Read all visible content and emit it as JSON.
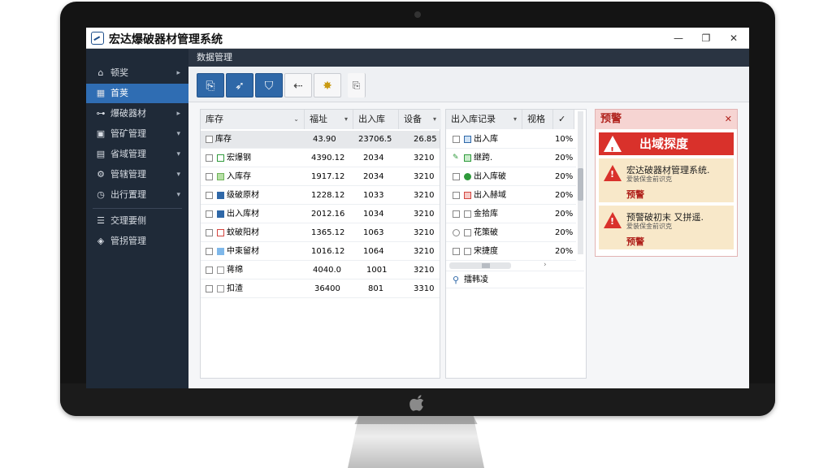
{
  "app": {
    "title": "宏达爆破器材管理系统"
  },
  "window_controls": {
    "minimize": "—",
    "maximize": "❐",
    "close": "✕"
  },
  "sidebar": {
    "items": [
      {
        "label": "顿奖",
        "icon": "home-icon",
        "arrow": "▸"
      },
      {
        "label": "首荚",
        "icon": "grid-icon",
        "arrow": ""
      },
      {
        "label": "爆破器材",
        "icon": "sitemap-icon",
        "arrow": "▸"
      },
      {
        "label": "管矿管理",
        "icon": "box-icon",
        "arrow": "▾"
      },
      {
        "label": "省域管理",
        "icon": "folder-icon",
        "arrow": "▾"
      },
      {
        "label": "管辖管理",
        "icon": "settings-icon",
        "arrow": "▾"
      },
      {
        "label": "出行置理",
        "icon": "clock-icon",
        "arrow": "▾"
      },
      {
        "label": "交理要侧",
        "icon": "list-icon",
        "arrow": ""
      },
      {
        "label": "管拐管理",
        "icon": "shield-icon",
        "arrow": ""
      }
    ]
  },
  "main": {
    "section_title": "数据管理",
    "toolbar": [
      {
        "name": "file-button",
        "icon": "file-icon",
        "glyph": "⎘",
        "style": "blue"
      },
      {
        "name": "rocket-button",
        "icon": "rocket-icon",
        "glyph": "➶",
        "style": "blue"
      },
      {
        "name": "filter-button",
        "icon": "filter-icon",
        "glyph": "⛉",
        "style": "blue"
      },
      {
        "name": "transfer-button",
        "icon": "transfer-icon",
        "glyph": "⇠",
        "style": "gray"
      },
      {
        "name": "burst-button",
        "icon": "burst-icon",
        "glyph": "✸",
        "style": "gray"
      },
      {
        "name": "copy-button",
        "icon": "copy-icon",
        "glyph": "⎘",
        "style": "plain"
      }
    ]
  },
  "inventory_table": {
    "columns": [
      {
        "label": "库存",
        "arrow": "⌄"
      },
      {
        "label": "福址",
        "arrow": "▾"
      },
      {
        "label": "出入库",
        "arrow": ""
      },
      {
        "label": "设备",
        "arrow": "▾"
      }
    ],
    "rows": [
      {
        "name": "库存",
        "a": "43.90",
        "b": "23706.5",
        "c": "26.85",
        "mark": "none"
      },
      {
        "name": "宏爆钢",
        "a": "4390.12",
        "b": "2034",
        "c": "3210",
        "mark": "green-box"
      },
      {
        "name": "入库存",
        "a": "1917.12",
        "b": "2034",
        "c": "3210",
        "mark": "green-folder"
      },
      {
        "name": "级破原材",
        "a": "1228.12",
        "b": "1033",
        "c": "3210",
        "mark": "blue-box"
      },
      {
        "name": "出入库材",
        "a": "2012.16",
        "b": "1034",
        "c": "3210",
        "mark": "blue-box"
      },
      {
        "name": "蚊破阳材",
        "a": "1365.12",
        "b": "1063",
        "c": "3210",
        "mark": "red-box"
      },
      {
        "name": "中束留材",
        "a": "1016.12",
        "b": "1064",
        "c": "3210",
        "mark": "lightblue-box"
      },
      {
        "name": "蒋绵",
        "a": "4040.0",
        "b": "1001",
        "c": "3210",
        "mark": "none"
      },
      {
        "name": "扣渣",
        "a": "36400",
        "b": "801",
        "c": "3310",
        "mark": "none"
      }
    ]
  },
  "records_table": {
    "columns": [
      {
        "label": "出入库记录",
        "arrow": "▾"
      },
      {
        "label": "视格",
        "arrow": ""
      },
      {
        "label": "✓",
        "arrow": ""
      }
    ],
    "rows": [
      {
        "name": "出入库",
        "pct": "10%",
        "mark": "blue-box"
      },
      {
        "name": "继跨.",
        "pct": "20%",
        "mark": "green-box"
      },
      {
        "name": "出入库破",
        "pct": "20%",
        "mark": "green-dot"
      },
      {
        "name": "出入赫域",
        "pct": "20%",
        "mark": "red-box"
      },
      {
        "name": "金拾库",
        "pct": "20%",
        "mark": "none"
      },
      {
        "name": "花策破",
        "pct": "20%",
        "mark": "none"
      },
      {
        "name": "宋捷度",
        "pct": "20%",
        "mark": "none"
      }
    ],
    "search_label": "擂韩凌"
  },
  "alerts": {
    "title": "预警",
    "close": "✕",
    "banner": "出域探度",
    "cards": [
      {
        "line1": "宏达破器材管理系统.",
        "line2": "爱装保金前识克",
        "tag": "预警"
      },
      {
        "line1": "预警破初末 又拼遥.",
        "line2": "爱装保金前识克",
        "tag": "预警"
      }
    ]
  },
  "colors": {
    "accent": "#2f68a8",
    "sidebar": "#1f2a38",
    "alert": "#d9312b",
    "warning_card": "#f8e8c9"
  }
}
